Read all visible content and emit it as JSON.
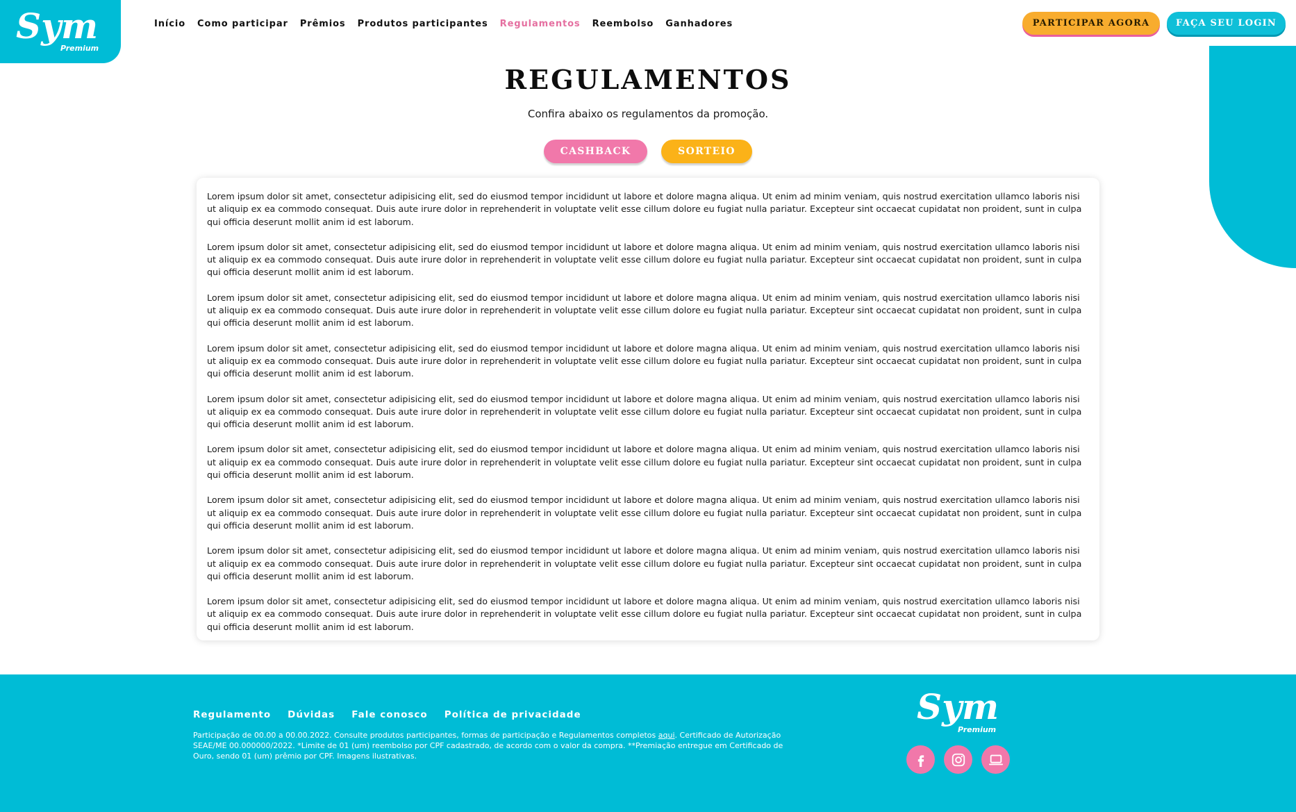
{
  "brand": {
    "logo_text": "Sym",
    "logo_sub": "Premium",
    "colors": {
      "cyan": "#00bcd6",
      "pink": "#f178aa",
      "orange": "#fbb218"
    }
  },
  "nav": {
    "items": [
      {
        "label": "Início",
        "active": false
      },
      {
        "label": "Como participar",
        "active": false
      },
      {
        "label": "Prêmios",
        "active": false
      },
      {
        "label": "Produtos participantes",
        "active": false
      },
      {
        "label": "Regulamentos",
        "active": true
      },
      {
        "label": "Reembolso",
        "active": false
      },
      {
        "label": "Ganhadores",
        "active": false
      }
    ]
  },
  "header": {
    "participar_label": "PARTICIPAR AGORA",
    "login_label": "FAÇA SEU LOGIN"
  },
  "main": {
    "title": "REGULAMENTOS",
    "subtitle": "Confira abaixo os regulamentos da promoção.",
    "tabs": [
      {
        "label": "CASHBACK"
      },
      {
        "label": "SORTEIO"
      }
    ],
    "paragraphs": [
      "Lorem ipsum dolor sit amet, consectetur adipisicing elit, sed do eiusmod tempor incididunt ut labore et dolore magna aliqua. Ut enim ad minim veniam, quis nostrud exercitation ullamco laboris nisi ut aliquip ex ea commodo consequat. Duis aute irure dolor in reprehenderit in voluptate velit esse cillum dolore eu fugiat nulla pariatur. Excepteur sint occaecat cupidatat non proident, sunt in culpa qui officia deserunt mollit anim id est laborum.",
      "Lorem ipsum dolor sit amet, consectetur adipisicing elit, sed do eiusmod tempor incididunt ut labore et dolore magna aliqua. Ut enim ad minim veniam, quis nostrud exercitation ullamco laboris nisi ut aliquip ex ea commodo consequat. Duis aute irure dolor in reprehenderit in voluptate velit esse cillum dolore eu fugiat nulla pariatur. Excepteur sint occaecat cupidatat non proident, sunt in culpa qui officia deserunt mollit anim id est laborum.",
      "Lorem ipsum dolor sit amet, consectetur adipisicing elit, sed do eiusmod tempor incididunt ut labore et dolore magna aliqua. Ut enim ad minim veniam, quis nostrud exercitation ullamco laboris nisi ut aliquip ex ea commodo consequat. Duis aute irure dolor in reprehenderit in voluptate velit esse cillum dolore eu fugiat nulla pariatur. Excepteur sint occaecat cupidatat non proident, sunt in culpa qui officia deserunt mollit anim id est laborum.",
      "Lorem ipsum dolor sit amet, consectetur adipisicing elit, sed do eiusmod tempor incididunt ut labore et dolore magna aliqua. Ut enim ad minim veniam, quis nostrud exercitation ullamco laboris nisi ut aliquip ex ea commodo consequat. Duis aute irure dolor in reprehenderit in voluptate velit esse cillum dolore eu fugiat nulla pariatur. Excepteur sint occaecat cupidatat non proident, sunt in culpa qui officia deserunt mollit anim id est laborum.",
      "Lorem ipsum dolor sit amet, consectetur adipisicing elit, sed do eiusmod tempor incididunt ut labore et dolore magna aliqua. Ut enim ad minim veniam, quis nostrud exercitation ullamco laboris nisi ut aliquip ex ea commodo consequat. Duis aute irure dolor in reprehenderit in voluptate velit esse cillum dolore eu fugiat nulla pariatur. Excepteur sint occaecat cupidatat non proident, sunt in culpa qui officia deserunt mollit anim id est laborum.",
      "Lorem ipsum dolor sit amet, consectetur adipisicing elit, sed do eiusmod tempor incididunt ut labore et dolore magna aliqua. Ut enim ad minim veniam, quis nostrud exercitation ullamco laboris nisi ut aliquip ex ea commodo consequat. Duis aute irure dolor in reprehenderit in voluptate velit esse cillum dolore eu fugiat nulla pariatur. Excepteur sint occaecat cupidatat non proident, sunt in culpa qui officia deserunt mollit anim id est laborum.",
      "Lorem ipsum dolor sit amet, consectetur adipisicing elit, sed do eiusmod tempor incididunt ut labore et dolore magna aliqua. Ut enim ad minim veniam, quis nostrud exercitation ullamco laboris nisi ut aliquip ex ea commodo consequat. Duis aute irure dolor in reprehenderit in voluptate velit esse cillum dolore eu fugiat nulla pariatur. Excepteur sint occaecat cupidatat non proident, sunt in culpa qui officia deserunt mollit anim id est laborum.",
      "Lorem ipsum dolor sit amet, consectetur adipisicing elit, sed do eiusmod tempor incididunt ut labore et dolore magna aliqua. Ut enim ad minim veniam, quis nostrud exercitation ullamco laboris nisi ut aliquip ex ea commodo consequat. Duis aute irure dolor in reprehenderit in voluptate velit esse cillum dolore eu fugiat nulla pariatur. Excepteur sint occaecat cupidatat non proident, sunt in culpa qui officia deserunt mollit anim id est laborum.",
      "Lorem ipsum dolor sit amet, consectetur adipisicing elit, sed do eiusmod tempor incididunt ut labore et dolore magna aliqua. Ut enim ad minim veniam, quis nostrud exercitation ullamco laboris nisi ut aliquip ex ea commodo consequat. Duis aute irure dolor in reprehenderit in voluptate velit esse cillum dolore eu fugiat nulla pariatur. Excepteur sint occaecat cupidatat non proident, sunt in culpa qui officia deserunt mollit anim id est laborum."
    ]
  },
  "footer": {
    "links": [
      {
        "label": "Regulamento"
      },
      {
        "label": "Dúvidas"
      },
      {
        "label": "Fale conosco"
      },
      {
        "label": "Política de privacidade"
      }
    ],
    "legal_before_link": "Participação de 00.00 a 00.00.2022. Consulte produtos participantes, formas de participação e Regulamentos completos ",
    "legal_link": "aqui",
    "legal_after_link": ". Certificado de Autorização SEAE/ME 00.000000/2022. *Limite de 01 (um) reembolso por CPF cadastrado, de acordo com o valor da compra. **Premiação entregue em Certificado de Ouro, sendo 01 (um) prêmio por CPF. Imagens ilustrativas.",
    "social": [
      {
        "icon": "facebook-icon"
      },
      {
        "icon": "instagram-icon"
      },
      {
        "icon": "laptop-icon"
      }
    ]
  }
}
